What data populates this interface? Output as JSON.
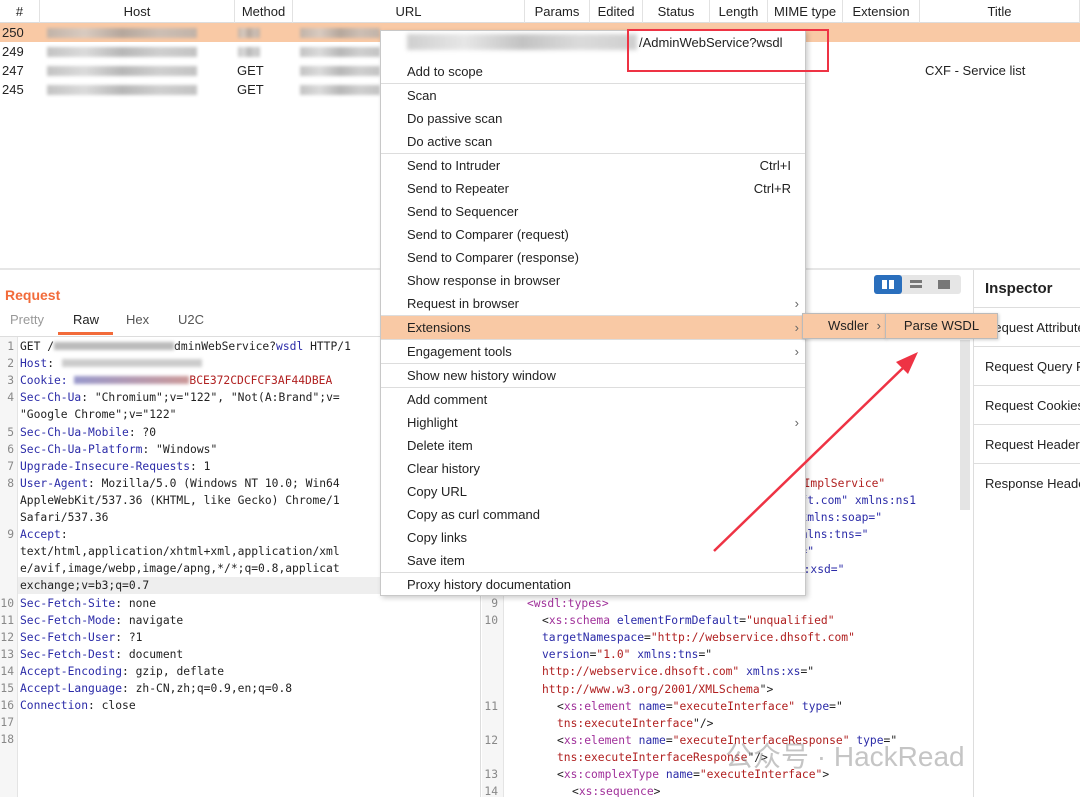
{
  "table": {
    "columns": [
      "#",
      "Host",
      "Method",
      "URL",
      "Params",
      "Edited",
      "Status",
      "Length",
      "MIME type",
      "Extension",
      "Title"
    ],
    "rows": [
      {
        "num": "250",
        "method": "",
        "title": "",
        "selected": true
      },
      {
        "num": "249",
        "method": "",
        "title": ""
      },
      {
        "num": "247",
        "method": "GET",
        "title": "CXF - Service list"
      },
      {
        "num": "245",
        "method": "GET",
        "title": ""
      }
    ]
  },
  "request": {
    "title": "Request",
    "tabs": [
      "Pretty",
      "Raw",
      "Hex",
      "U2C"
    ],
    "active_tab": "Raw",
    "lines": [
      {
        "n": "1",
        "k": "GET /",
        "v": "dminWebService?",
        "x": "wsdl",
        " r": "",
        "rest": " HTTP/1"
      },
      {
        "n": "2",
        "k": "Host",
        "rest": ":"
      },
      {
        "n": "3",
        "k": "Cookie:",
        "rest": " ",
        "val": "BCE372CDCFCF3AF44DBEA"
      },
      {
        "n": "4",
        "k": "Sec-Ch-Ua",
        "rest": ": \"Chromium\";v=\"122\", \"Not(A:Brand\";v="
      },
      {
        "n": "",
        "k": "",
        "rest": "\"Google Chrome\";v=\"122\""
      },
      {
        "n": "5",
        "k": "Sec-Ch-Ua-Mobile",
        "rest": ": ?0"
      },
      {
        "n": "6",
        "k": "Sec-Ch-Ua-Platform",
        "rest": ": \"Windows\""
      },
      {
        "n": "7",
        "k": "Upgrade-Insecure-Requests",
        "rest": ": 1"
      },
      {
        "n": "8",
        "k": "User-Agent",
        "rest": ": Mozilla/5.0 (Windows NT 10.0; Win64"
      },
      {
        "n": "",
        "k": "",
        "rest": "AppleWebKit/537.36 (KHTML, like Gecko) Chrome/1"
      },
      {
        "n": "",
        "k": "",
        "rest": "Safari/537.36"
      },
      {
        "n": "9",
        "k": "Accept",
        "rest": ":"
      },
      {
        "n": "",
        "k": "",
        "rest": "text/html,application/xhtml+xml,application/xml"
      },
      {
        "n": "",
        "k": "",
        "rest": "e/avif,image/webp,image/apng,*/*;q=0.8,applicat"
      },
      {
        "n": "",
        "k": "",
        "rest": "exchange;v=b3;q=0.7"
      },
      {
        "n": "10",
        "k": "Sec-Fetch-Site",
        "rest": ": none"
      },
      {
        "n": "11",
        "k": "Sec-Fetch-Mode",
        "rest": ": navigate"
      },
      {
        "n": "12",
        "k": "Sec-Fetch-User",
        "rest": ": ?1"
      },
      {
        "n": "13",
        "k": "Sec-Fetch-Dest",
        "rest": ": document"
      },
      {
        "n": "14",
        "k": "Accept-Encoding",
        "rest": ": gzip, deflate"
      },
      {
        "n": "15",
        "k": "Accept-Language",
        "rest": ": zh-CN,zh;q=0.9,en;q=0.8"
      },
      {
        "n": "16",
        "k": "Connection",
        "rest": ": close"
      },
      {
        "n": "17",
        "k": "",
        "rest": ""
      },
      {
        "n": "18",
        "k": "",
        "rest": ""
      }
    ]
  },
  "response": {
    "fragments": [
      "ceImplService\"",
      "nsoft.com\" xmlns:ns1",
      "p\" xmlns:soap=\"",
      "\" xmlns:tns=\"",
      "sdl=\"",
      "ns:xsd=\""
    ],
    "lines": [
      {
        "n": "9",
        "html": "<span class='t'>&lt;wsdl:types&gt;</span>",
        "indent": 2
      },
      {
        "n": "10",
        "html": "&lt;<span class='t'>xs:schema</span> <span class='k'>elementFormDefault</span>=<span class='v'>\"unqualified\"</span>",
        "indent": 4
      },
      {
        "n": "",
        "html": "<span class='k'>targetNamespace</span>=<span class='v'>\"http://webservice.dhsoft.com\"</span>",
        "indent": 4
      },
      {
        "n": "",
        "html": "<span class='k'>version</span>=<span class='v'>\"1.0\"</span> <span class='k'>xmlns:tns</span>=\"",
        "indent": 4
      },
      {
        "n": "",
        "html": "<span class='v'>http://webservice.dhsoft.com\"</span> <span class='k'>xmlns:xs</span>=\"",
        "indent": 4
      },
      {
        "n": "",
        "html": "<span class='v'>http://www.w3.org/2001/XMLSchema</span>\"&gt;",
        "indent": 4
      },
      {
        "n": "11",
        "html": "&lt;<span class='t'>xs:element</span> <span class='k'>name</span>=<span class='v'>\"executeInterface\"</span> <span class='k'>type</span>=\"",
        "indent": 6
      },
      {
        "n": "",
        "html": "<span class='v'>tns:executeInterface</span>\"/&gt;",
        "indent": 6
      },
      {
        "n": "12",
        "html": "&lt;<span class='t'>xs:element</span> <span class='k'>name</span>=<span class='v'>\"executeInterfaceResponse\"</span> <span class='k'>type</span>=\"",
        "indent": 6
      },
      {
        "n": "",
        "html": "<span class='v'>tns:executeInterfaceResponse</span>\"/&gt;",
        "indent": 6
      },
      {
        "n": "13",
        "html": "&lt;<span class='t'>xs:complexType</span> <span class='k'>name</span>=<span class='v'>\"executeInterface\"</span>&gt;",
        "indent": 6
      },
      {
        "n": "14",
        "html": "&lt;<span class='t'>xs:sequence</span>&gt;",
        "indent": 8
      }
    ]
  },
  "context_menu": {
    "url_suffix": "/AdminWebService?wsdl",
    "items": [
      {
        "label": "Add to scope"
      },
      {
        "label": "Scan",
        "sep": true
      },
      {
        "label": "Do passive scan"
      },
      {
        "label": "Do active scan"
      },
      {
        "label": "Send to Intruder",
        "shortcut": "Ctrl+I",
        "sep": true
      },
      {
        "label": "Send to Repeater",
        "shortcut": "Ctrl+R"
      },
      {
        "label": "Send to Sequencer"
      },
      {
        "label": "Send to Comparer (request)"
      },
      {
        "label": "Send to Comparer (response)"
      },
      {
        "label": "Show response in browser"
      },
      {
        "label": "Request in browser",
        "submenu": true
      },
      {
        "label": "Extensions",
        "submenu": true,
        "highlighted": true,
        "sep": true
      },
      {
        "label": "Engagement tools",
        "submenu": true,
        "sep": true
      },
      {
        "label": "Show new history window",
        "sep": true
      },
      {
        "label": "Add comment",
        "sep": true
      },
      {
        "label": "Highlight",
        "submenu": true
      },
      {
        "label": "Delete item"
      },
      {
        "label": "Clear history"
      },
      {
        "label": "Copy URL"
      },
      {
        "label": "Copy as curl command"
      },
      {
        "label": "Copy links"
      },
      {
        "label": "Save item"
      },
      {
        "label": "Proxy history documentation",
        "sep": true
      }
    ],
    "submenu": {
      "label": "Wsdler",
      "item": "Parse WSDL"
    }
  },
  "inspector": {
    "title": "Inspector",
    "items": [
      "Request Attributes",
      "Request Query Parameters",
      "Request Cookies",
      "Request Headers",
      "Response Headers"
    ]
  },
  "watermark": "公众号 · HackRead",
  "colors": {
    "accent": "#f26b3a",
    "selection": "#f9c9a5",
    "annotation": "#ee3344",
    "view_toggle": "#2a6fbd"
  }
}
